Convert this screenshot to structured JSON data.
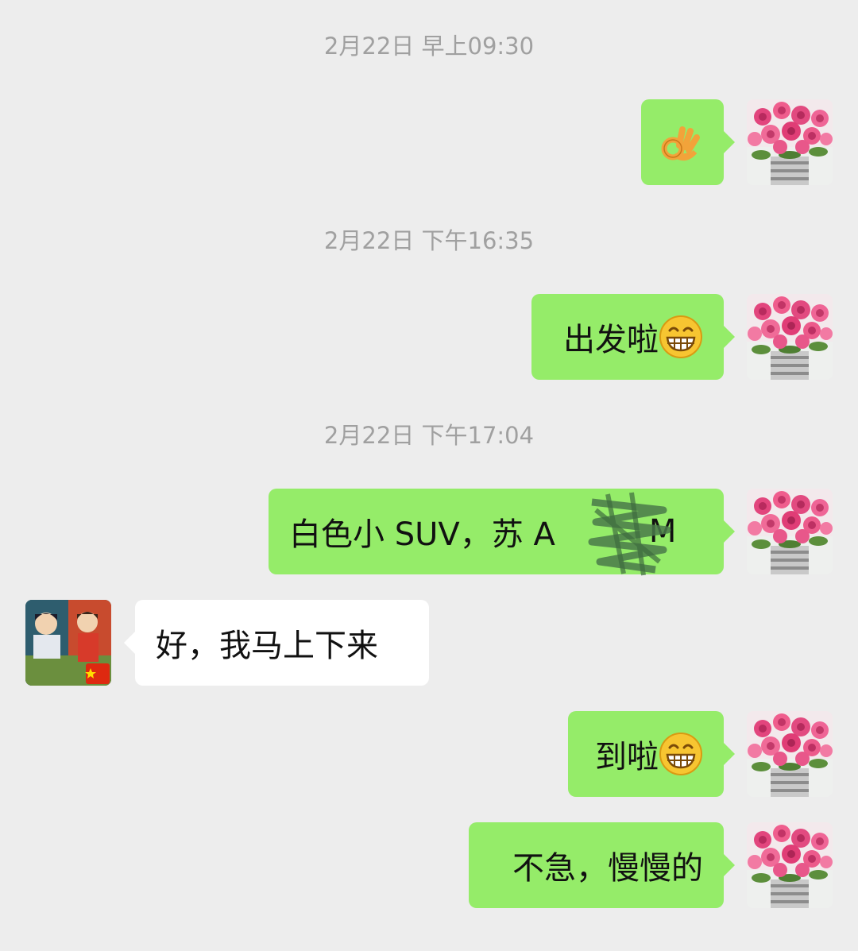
{
  "conversation": {
    "messages": [
      {
        "kind": "timestamp",
        "text": "2月22日 早上09:30"
      },
      {
        "kind": "sent",
        "text": "",
        "emoji": "ok-hand-emoji"
      },
      {
        "kind": "timestamp",
        "text": "2月22日 下午16:35"
      },
      {
        "kind": "sent",
        "text": "出发啦",
        "emoji": "grinning-face-emoji"
      },
      {
        "kind": "timestamp",
        "text": "2月22日 下午17:04"
      },
      {
        "kind": "sent",
        "text": "白色小 SUV，苏 A",
        "tail_text": "M",
        "note": "license plate partially scribbled out"
      },
      {
        "kind": "received",
        "text": "好，我马上下来"
      },
      {
        "kind": "sent",
        "text": "到啦",
        "emoji": "grinning-face-emoji"
      },
      {
        "kind": "sent",
        "text": "不急，慢慢的"
      }
    ]
  },
  "avatars": {
    "me": "pink-roses-bouquet-avatar",
    "other": "anime-couple-avatar-with-flag-badge"
  },
  "colors": {
    "background": "#ededed",
    "sent_bubble": "#95ec69",
    "received_bubble": "#ffffff",
    "timestamp_text": "#a0a0a0"
  }
}
